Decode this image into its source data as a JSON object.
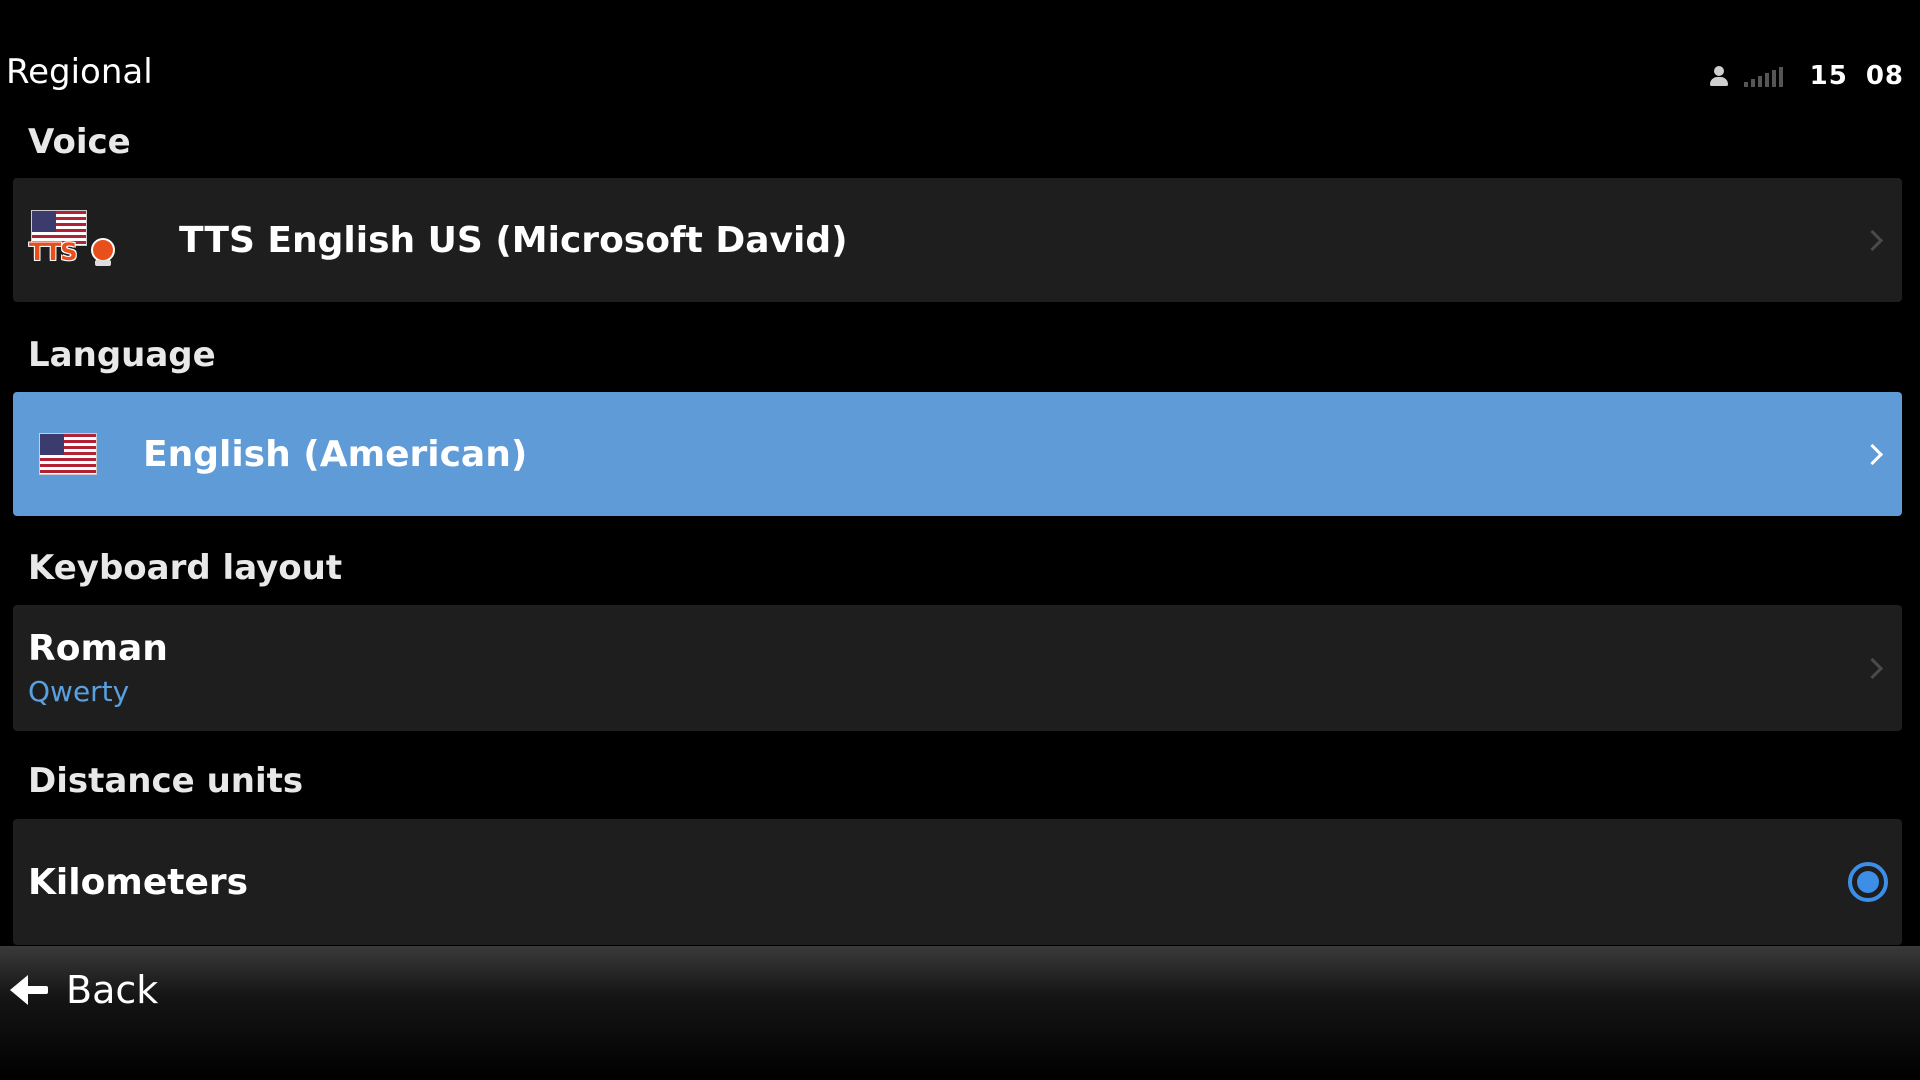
{
  "header": {
    "title": "Regional",
    "clock_hours": "15",
    "clock_minutes": "08"
  },
  "sections": {
    "voice": {
      "heading": "Voice",
      "item_label": "TTS English US (Microsoft David)",
      "icon_text": "TTS"
    },
    "language": {
      "heading": "Language",
      "item_label": "English (American)"
    },
    "keyboard": {
      "heading": "Keyboard layout",
      "item_label": "Roman",
      "item_sublabel": "Qwerty"
    },
    "distance": {
      "heading": "Distance units",
      "item_label": "Kilometers",
      "selected": true
    }
  },
  "footer": {
    "back_label": "Back"
  },
  "colors": {
    "selected_row": "#5f9bd6",
    "row_bg": "#1e1e1e",
    "accent_blue": "#3d8ee6",
    "sublabel_blue": "#5a9fe0"
  }
}
